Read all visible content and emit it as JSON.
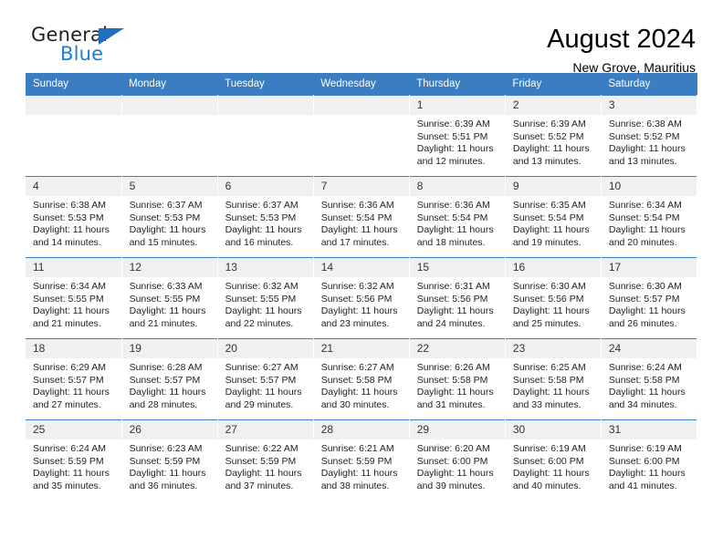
{
  "logo": {
    "word_one": "General",
    "word_two": "Blue",
    "triangle_color": "#1f6fba",
    "text_color": "#231f20",
    "blue_color": "#1c7fd4"
  },
  "header": {
    "title": "August 2024",
    "subtitle": "New Grove, Mauritius"
  },
  "calendar": {
    "header_bg": "#3a7dc0",
    "daynum_bg": "#f0f0f0",
    "weekdays": [
      "Sunday",
      "Monday",
      "Tuesday",
      "Wednesday",
      "Thursday",
      "Friday",
      "Saturday"
    ],
    "weeks": [
      [
        {
          "day": "",
          "sunrise": "",
          "sunset": "",
          "daylight_line1": "",
          "daylight_line2": "",
          "empty": true
        },
        {
          "day": "",
          "sunrise": "",
          "sunset": "",
          "daylight_line1": "",
          "daylight_line2": "",
          "empty": true
        },
        {
          "day": "",
          "sunrise": "",
          "sunset": "",
          "daylight_line1": "",
          "daylight_line2": "",
          "empty": true
        },
        {
          "day": "",
          "sunrise": "",
          "sunset": "",
          "daylight_line1": "",
          "daylight_line2": "",
          "empty": true
        },
        {
          "day": "1",
          "sunrise": "Sunrise: 6:39 AM",
          "sunset": "Sunset: 5:51 PM",
          "daylight_line1": "Daylight: 11 hours",
          "daylight_line2": "and 12 minutes."
        },
        {
          "day": "2",
          "sunrise": "Sunrise: 6:39 AM",
          "sunset": "Sunset: 5:52 PM",
          "daylight_line1": "Daylight: 11 hours",
          "daylight_line2": "and 13 minutes."
        },
        {
          "day": "3",
          "sunrise": "Sunrise: 6:38 AM",
          "sunset": "Sunset: 5:52 PM",
          "daylight_line1": "Daylight: 11 hours",
          "daylight_line2": "and 13 minutes."
        }
      ],
      [
        {
          "day": "4",
          "sunrise": "Sunrise: 6:38 AM",
          "sunset": "Sunset: 5:53 PM",
          "daylight_line1": "Daylight: 11 hours",
          "daylight_line2": "and 14 minutes."
        },
        {
          "day": "5",
          "sunrise": "Sunrise: 6:37 AM",
          "sunset": "Sunset: 5:53 PM",
          "daylight_line1": "Daylight: 11 hours",
          "daylight_line2": "and 15 minutes."
        },
        {
          "day": "6",
          "sunrise": "Sunrise: 6:37 AM",
          "sunset": "Sunset: 5:53 PM",
          "daylight_line1": "Daylight: 11 hours",
          "daylight_line2": "and 16 minutes."
        },
        {
          "day": "7",
          "sunrise": "Sunrise: 6:36 AM",
          "sunset": "Sunset: 5:54 PM",
          "daylight_line1": "Daylight: 11 hours",
          "daylight_line2": "and 17 minutes."
        },
        {
          "day": "8",
          "sunrise": "Sunrise: 6:36 AM",
          "sunset": "Sunset: 5:54 PM",
          "daylight_line1": "Daylight: 11 hours",
          "daylight_line2": "and 18 minutes."
        },
        {
          "day": "9",
          "sunrise": "Sunrise: 6:35 AM",
          "sunset": "Sunset: 5:54 PM",
          "daylight_line1": "Daylight: 11 hours",
          "daylight_line2": "and 19 minutes."
        },
        {
          "day": "10",
          "sunrise": "Sunrise: 6:34 AM",
          "sunset": "Sunset: 5:54 PM",
          "daylight_line1": "Daylight: 11 hours",
          "daylight_line2": "and 20 minutes."
        }
      ],
      [
        {
          "day": "11",
          "sunrise": "Sunrise: 6:34 AM",
          "sunset": "Sunset: 5:55 PM",
          "daylight_line1": "Daylight: 11 hours",
          "daylight_line2": "and 21 minutes."
        },
        {
          "day": "12",
          "sunrise": "Sunrise: 6:33 AM",
          "sunset": "Sunset: 5:55 PM",
          "daylight_line1": "Daylight: 11 hours",
          "daylight_line2": "and 21 minutes."
        },
        {
          "day": "13",
          "sunrise": "Sunrise: 6:32 AM",
          "sunset": "Sunset: 5:55 PM",
          "daylight_line1": "Daylight: 11 hours",
          "daylight_line2": "and 22 minutes."
        },
        {
          "day": "14",
          "sunrise": "Sunrise: 6:32 AM",
          "sunset": "Sunset: 5:56 PM",
          "daylight_line1": "Daylight: 11 hours",
          "daylight_line2": "and 23 minutes."
        },
        {
          "day": "15",
          "sunrise": "Sunrise: 6:31 AM",
          "sunset": "Sunset: 5:56 PM",
          "daylight_line1": "Daylight: 11 hours",
          "daylight_line2": "and 24 minutes."
        },
        {
          "day": "16",
          "sunrise": "Sunrise: 6:30 AM",
          "sunset": "Sunset: 5:56 PM",
          "daylight_line1": "Daylight: 11 hours",
          "daylight_line2": "and 25 minutes."
        },
        {
          "day": "17",
          "sunrise": "Sunrise: 6:30 AM",
          "sunset": "Sunset: 5:57 PM",
          "daylight_line1": "Daylight: 11 hours",
          "daylight_line2": "and 26 minutes."
        }
      ],
      [
        {
          "day": "18",
          "sunrise": "Sunrise: 6:29 AM",
          "sunset": "Sunset: 5:57 PM",
          "daylight_line1": "Daylight: 11 hours",
          "daylight_line2": "and 27 minutes."
        },
        {
          "day": "19",
          "sunrise": "Sunrise: 6:28 AM",
          "sunset": "Sunset: 5:57 PM",
          "daylight_line1": "Daylight: 11 hours",
          "daylight_line2": "and 28 minutes."
        },
        {
          "day": "20",
          "sunrise": "Sunrise: 6:27 AM",
          "sunset": "Sunset: 5:57 PM",
          "daylight_line1": "Daylight: 11 hours",
          "daylight_line2": "and 29 minutes."
        },
        {
          "day": "21",
          "sunrise": "Sunrise: 6:27 AM",
          "sunset": "Sunset: 5:58 PM",
          "daylight_line1": "Daylight: 11 hours",
          "daylight_line2": "and 30 minutes."
        },
        {
          "day": "22",
          "sunrise": "Sunrise: 6:26 AM",
          "sunset": "Sunset: 5:58 PM",
          "daylight_line1": "Daylight: 11 hours",
          "daylight_line2": "and 31 minutes."
        },
        {
          "day": "23",
          "sunrise": "Sunrise: 6:25 AM",
          "sunset": "Sunset: 5:58 PM",
          "daylight_line1": "Daylight: 11 hours",
          "daylight_line2": "and 33 minutes."
        },
        {
          "day": "24",
          "sunrise": "Sunrise: 6:24 AM",
          "sunset": "Sunset: 5:58 PM",
          "daylight_line1": "Daylight: 11 hours",
          "daylight_line2": "and 34 minutes."
        }
      ],
      [
        {
          "day": "25",
          "sunrise": "Sunrise: 6:24 AM",
          "sunset": "Sunset: 5:59 PM",
          "daylight_line1": "Daylight: 11 hours",
          "daylight_line2": "and 35 minutes."
        },
        {
          "day": "26",
          "sunrise": "Sunrise: 6:23 AM",
          "sunset": "Sunset: 5:59 PM",
          "daylight_line1": "Daylight: 11 hours",
          "daylight_line2": "and 36 minutes."
        },
        {
          "day": "27",
          "sunrise": "Sunrise: 6:22 AM",
          "sunset": "Sunset: 5:59 PM",
          "daylight_line1": "Daylight: 11 hours",
          "daylight_line2": "and 37 minutes."
        },
        {
          "day": "28",
          "sunrise": "Sunrise: 6:21 AM",
          "sunset": "Sunset: 5:59 PM",
          "daylight_line1": "Daylight: 11 hours",
          "daylight_line2": "and 38 minutes."
        },
        {
          "day": "29",
          "sunrise": "Sunrise: 6:20 AM",
          "sunset": "Sunset: 6:00 PM",
          "daylight_line1": "Daylight: 11 hours",
          "daylight_line2": "and 39 minutes."
        },
        {
          "day": "30",
          "sunrise": "Sunrise: 6:19 AM",
          "sunset": "Sunset: 6:00 PM",
          "daylight_line1": "Daylight: 11 hours",
          "daylight_line2": "and 40 minutes."
        },
        {
          "day": "31",
          "sunrise": "Sunrise: 6:19 AM",
          "sunset": "Sunset: 6:00 PM",
          "daylight_line1": "Daylight: 11 hours",
          "daylight_line2": "and 41 minutes."
        }
      ]
    ]
  }
}
